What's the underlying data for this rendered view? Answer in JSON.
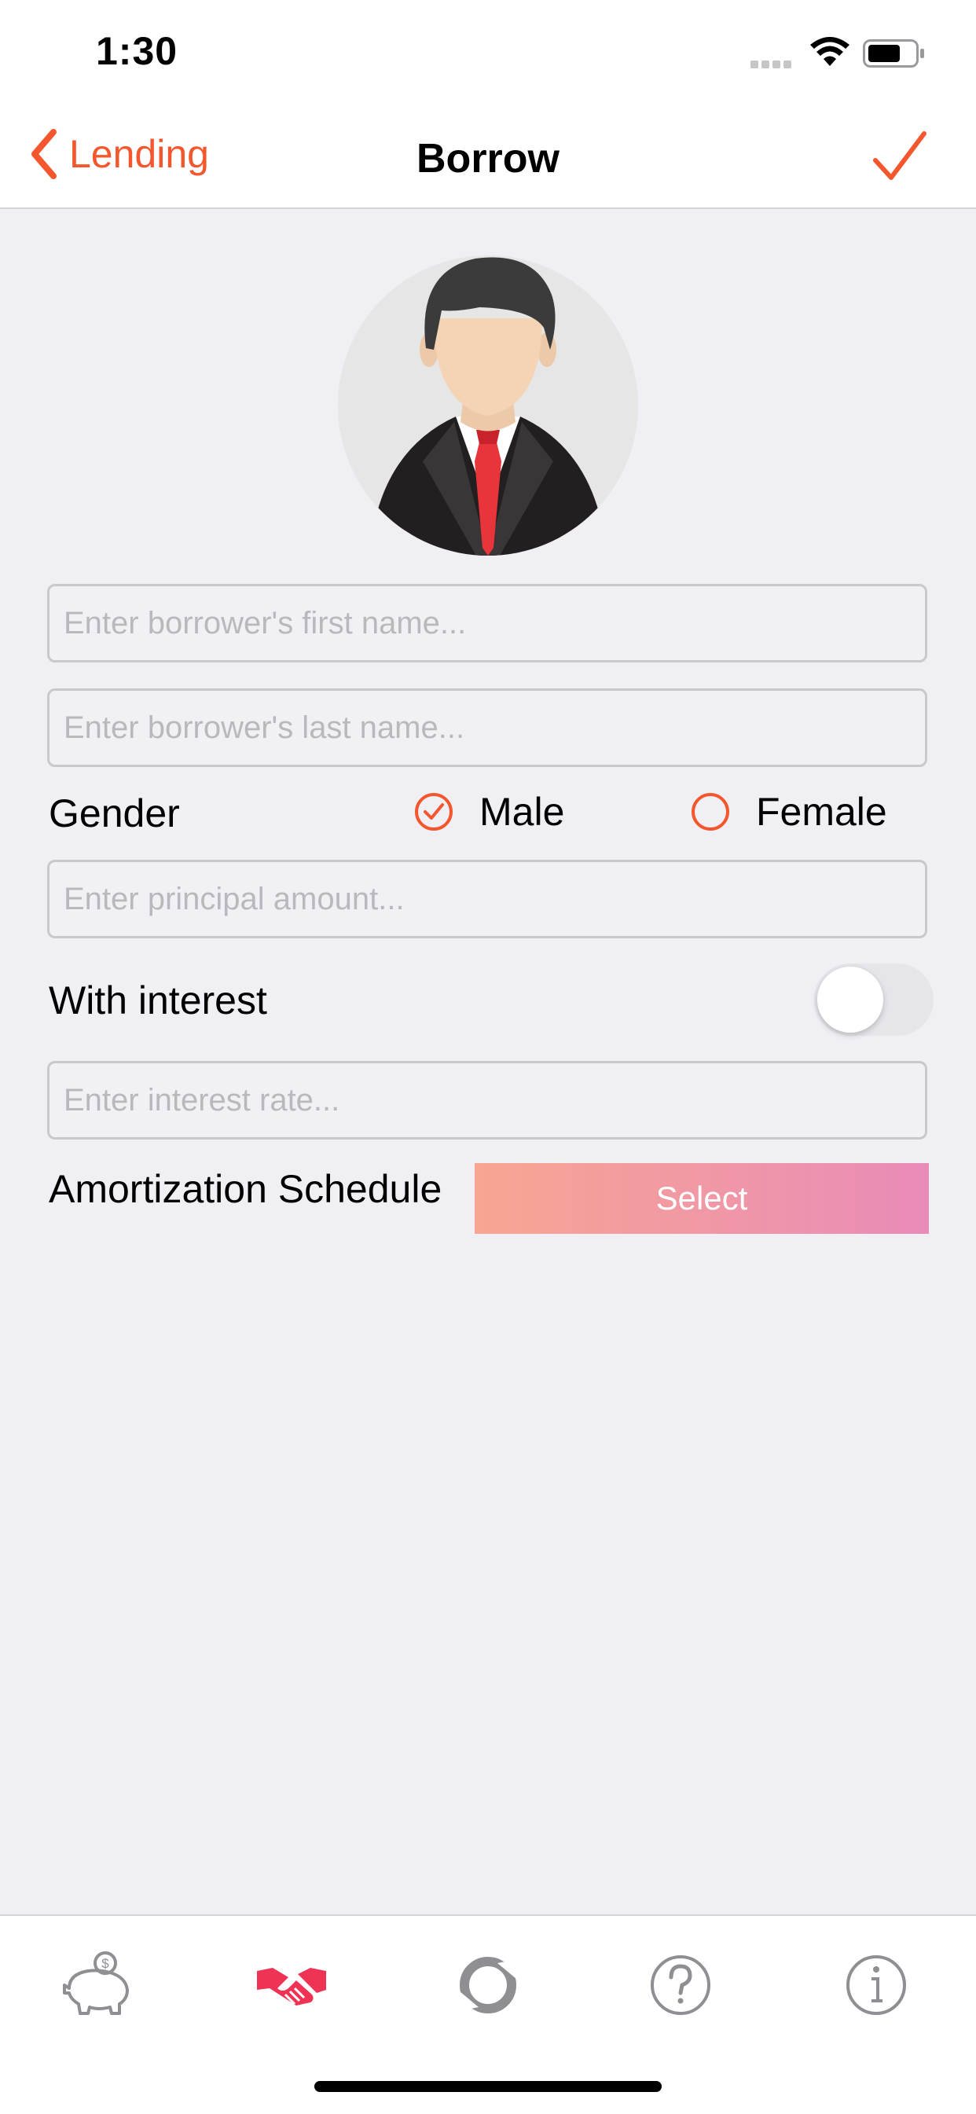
{
  "status_bar": {
    "time": "1:30"
  },
  "nav": {
    "back_label": "Lending",
    "title": "Borrow"
  },
  "form": {
    "first_name_placeholder": "Enter borrower's first name...",
    "last_name_placeholder": "Enter borrower's last name...",
    "gender_label": "Gender",
    "gender_options": [
      {
        "label": "Male",
        "selected": true
      },
      {
        "label": "Female",
        "selected": false
      }
    ],
    "principal_placeholder": "Enter principal amount...",
    "with_interest_label": "With interest",
    "with_interest_on": false,
    "interest_rate_placeholder": "Enter interest rate...",
    "amortization_label": "Amortization Schedule",
    "select_label": "Select"
  },
  "tab_bar": {
    "items": [
      {
        "icon": "piggy-bank-icon",
        "active": false
      },
      {
        "icon": "handshake-icon",
        "active": true
      },
      {
        "icon": "refresh-icon",
        "active": false
      },
      {
        "icon": "help-icon",
        "active": false
      },
      {
        "icon": "info-icon",
        "active": false
      }
    ]
  },
  "colors": {
    "accent": "#f4572e",
    "background": "#efeff4",
    "select_gradient_start": "#f8a592",
    "select_gradient_end": "#e98bb8",
    "tab_active": "#ee3355",
    "tab_inactive": "#8e8e93"
  }
}
